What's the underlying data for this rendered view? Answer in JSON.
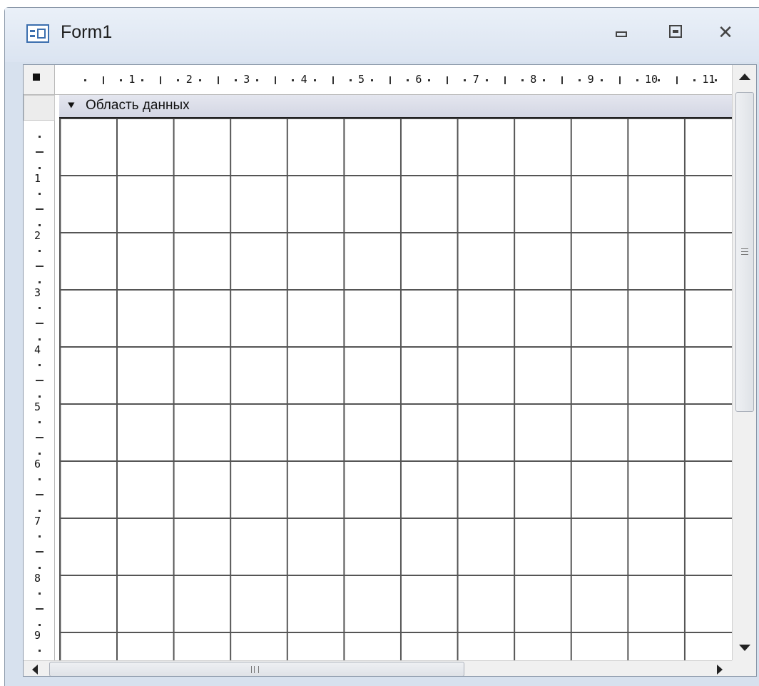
{
  "window": {
    "title": "Form1",
    "controls": [
      "minimize",
      "restore",
      "close"
    ],
    "close_glyph": "✕"
  },
  "ruler": {
    "horizontal_labels": [
      "1",
      "2",
      "3",
      "4",
      "5",
      "6",
      "7",
      "8",
      "9",
      "10",
      "11"
    ],
    "vertical_labels": [
      "1",
      "2",
      "3",
      "4",
      "5",
      "6",
      "7",
      "8",
      "9"
    ]
  },
  "section": {
    "label": "Область данных",
    "arrow_glyph": "⯆"
  },
  "colors": {
    "title_bar": "#dbe4f1",
    "section_bar": "#d3d6e3",
    "grid_lines": "#555555"
  }
}
